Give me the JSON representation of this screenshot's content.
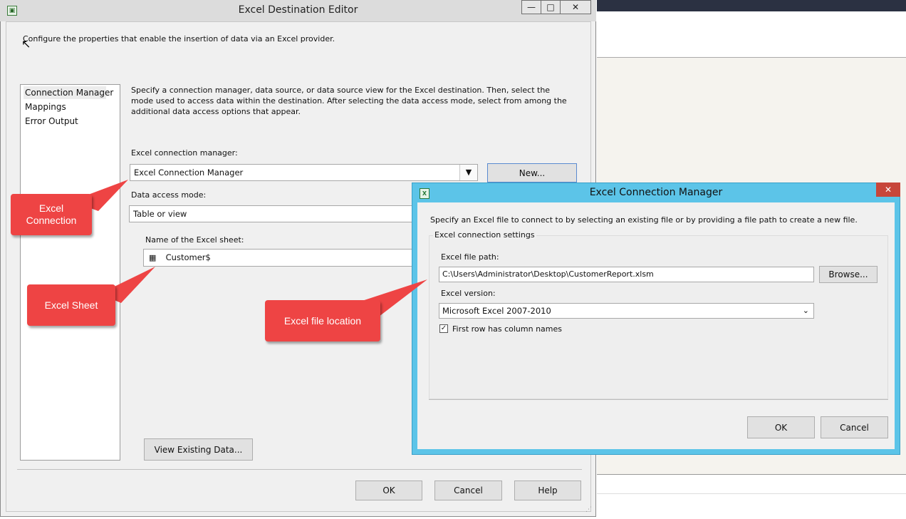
{
  "main_dialog": {
    "title": "Excel Destination Editor",
    "description": "Configure the properties that enable the insertion of data via an Excel provider.",
    "minimize_label": "—",
    "maximize_label": "□",
    "close_label": "✕",
    "nav": [
      "Connection Manager",
      "Mappings",
      "Error Output"
    ],
    "intro": "Specify a connection manager, data source, or data source view for the Excel destination. Then, select the mode used to access data within the destination. After selecting the data access mode, select from among the additional data access options that appear.",
    "connection_manager_label": "Excel connection manager:",
    "connection_manager_value": "Excel Connection Manager",
    "new_button": "New...",
    "data_access_mode_label": "Data access mode:",
    "data_access_mode_value": "Table or view",
    "sheet_label": "Name of the Excel sheet:",
    "sheet_value": "Customer$",
    "view_data_button": "View Existing Data...",
    "ok_button": "OK",
    "cancel_button": "Cancel",
    "help_button": "Help"
  },
  "connection_dialog": {
    "title": "Excel Connection Manager",
    "close_label": "✕",
    "description": "Specify an Excel file to connect to by selecting an existing file or by providing a file path to create a new file.",
    "group_title": "Excel connection settings",
    "file_path_label": "Excel file path:",
    "file_path_value": "C:\\Users\\Administrator\\Desktop\\CustomerReport.xlsm",
    "browse_button": "Browse...",
    "version_label": "Excel version:",
    "version_value": "Microsoft Excel 2007-2010",
    "first_row_label": "First row has column names",
    "first_row_checked": true,
    "ok_button": "OK",
    "cancel_button": "Cancel"
  },
  "callouts": {
    "excel_connection_line1": "Excel",
    "excel_connection_line2": "Connection",
    "excel_sheet": "Excel Sheet",
    "excel_file_location": "Excel file location"
  },
  "colors": {
    "callout": "#ee4444",
    "sub_dialog_frame": "#5cc4e8",
    "close_button": "#c7463a"
  }
}
